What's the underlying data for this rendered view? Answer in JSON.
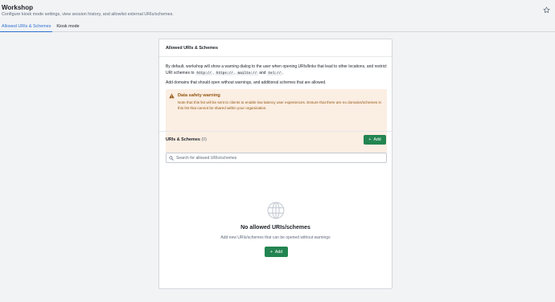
{
  "header": {
    "title": "Workshop",
    "subtitle": "Configure kiosk mode settings, view session history, and allowlist external URIs/schemes.",
    "tabs": [
      {
        "label": "Allowed URIs & Schemes",
        "active": true
      },
      {
        "label": "Kiosk mode",
        "active": false
      }
    ],
    "star_icon": "star-icon"
  },
  "panel": {
    "title": "Allowed URIs & Schemes",
    "description": {
      "part1": "By default, workshop will show a warning dialog to the user when opening URIs/links that lead to other locations, and restrict URI schemes to",
      "schemes": [
        "http://",
        "https://",
        "mailto://",
        "tel://"
      ],
      "sep1": ",",
      "sep2": ",",
      "sep3": "and",
      "end": ".",
      "line2": "Add domains that should open without warnings, and additional schemes that are allowed."
    },
    "warning": {
      "icon": "warning-icon",
      "title": "Data safety warning",
      "body": "Note that this list will be sent to clients to enable low latency user experiences. Ensure that there are no domains/schemes in this list that cannot be shared within your organization."
    },
    "list": {
      "title": "URIs & Schemes",
      "count": "(0)",
      "add_label": "Add",
      "search_placeholder": "Search for allowed URIs/schemes"
    },
    "empty": {
      "icon": "globe-icon",
      "title": "No allowed URIs/schemes",
      "subtitle": "Add new URIs/schemes that can be opened without warnings",
      "add_label": "Add"
    }
  },
  "colors": {
    "accent": "#2d72d2",
    "button_green": "#238551",
    "warning_bg": "#fbeee3",
    "warning_text": "#935610"
  }
}
